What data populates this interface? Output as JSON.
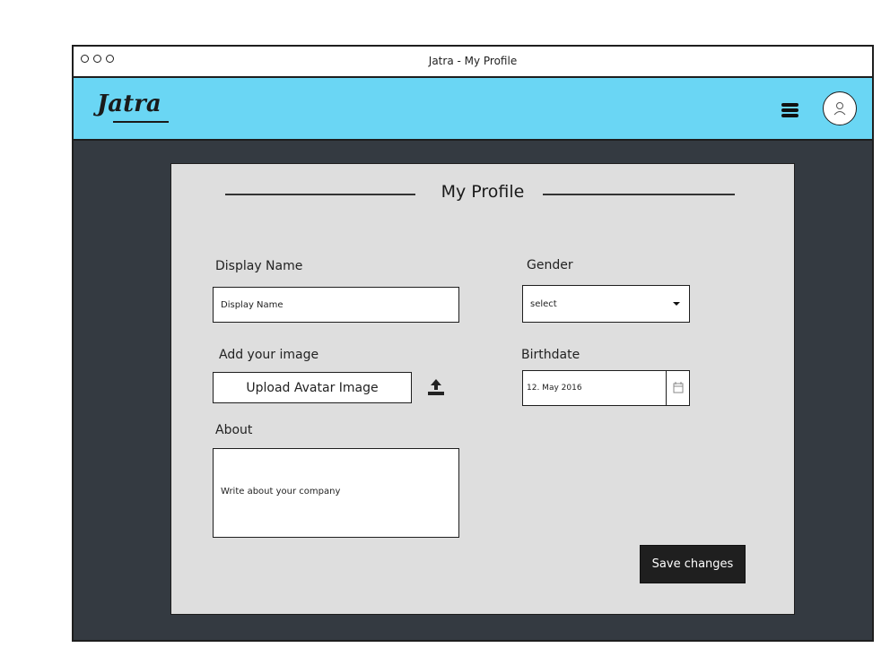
{
  "window": {
    "title": "Jatra - My Profile"
  },
  "navbar": {
    "logo": "Jatra",
    "menu_icon": "hamburger-menu-icon",
    "avatar_icon": "user-avatar-icon",
    "bg_color": "#6ad6f4"
  },
  "profile_form": {
    "title": "My Profile",
    "display_name": {
      "label": "Display Name",
      "placeholder": "Display Name"
    },
    "gender": {
      "label": "Gender",
      "selected": "select"
    },
    "image": {
      "label": "Add your image",
      "button": "Upload Avatar Image",
      "icon": "upload-icon"
    },
    "birthdate": {
      "label": "Birthdate",
      "value": "12. May 2016",
      "icon": "calendar-icon"
    },
    "about": {
      "label": "About",
      "placeholder": "Write about your company"
    },
    "save_button": "Save changes"
  },
  "colors": {
    "background": "#343a41",
    "card": "#dedede",
    "accent": "#6ad6f4",
    "button": "#1f1f1f"
  }
}
